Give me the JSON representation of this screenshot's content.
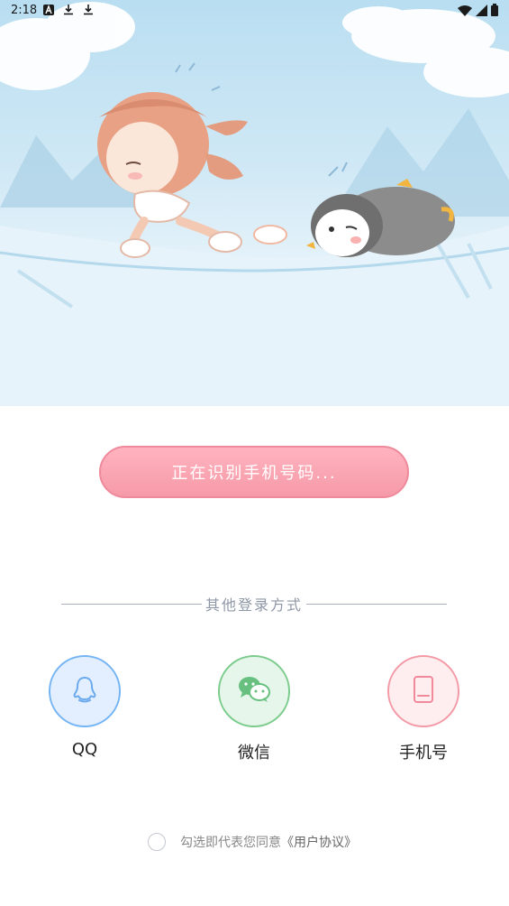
{
  "status_bar": {
    "time": "2:18",
    "left_icons": [
      "font-a-icon",
      "download-icon",
      "download-icon"
    ],
    "right_icons": [
      "wifi-icon",
      "signal-icon",
      "battery-icon"
    ]
  },
  "hero": {
    "illustration": "girl-chasing-penguin"
  },
  "primary_button": {
    "label": "正在识别手机号码..."
  },
  "divider": {
    "label": "其他登录方式"
  },
  "login_options": [
    {
      "label": "QQ",
      "icon": "qq-icon",
      "color": "#76b5f4"
    },
    {
      "label": "微信",
      "icon": "wechat-icon",
      "color": "#7ccc8e"
    },
    {
      "label": "手机号",
      "icon": "phone-icon",
      "color": "#f39aa7"
    }
  ],
  "agreement": {
    "text": "勾选即代表您同意",
    "link": "《用户协议》",
    "checked": false
  },
  "colors": {
    "primary": "#f69aa8",
    "sky": "#b9def1"
  }
}
